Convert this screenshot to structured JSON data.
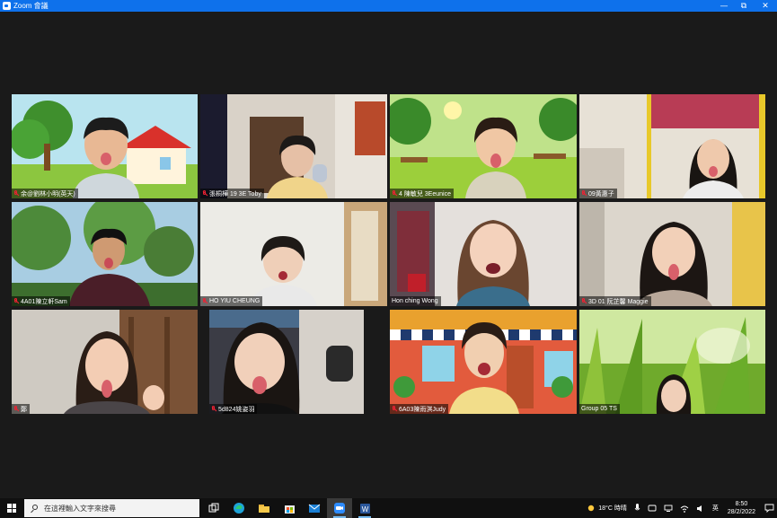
{
  "window": {
    "title": "Zoom 會議"
  },
  "controls": {
    "minimize": "—",
    "restore": "⧉",
    "close": "✕"
  },
  "gallery": [
    {
      "name": "余@劉林小明(英天)",
      "muted": true
    },
    {
      "name": "張桐樺 19 3E Toby",
      "muted": true
    },
    {
      "name": "4 陳敏兒 3Eeunice",
      "muted": true
    },
    {
      "name": "09黃惠子",
      "muted": true
    },
    {
      "name": "4A01陳立軒Sam",
      "muted": true
    },
    {
      "name": "HO YIU CHEUNG",
      "muted": true
    },
    {
      "name": "Hon ching Wong",
      "muted": false,
      "active": true
    },
    {
      "name": "3D 01 阮芷馨 Maggie",
      "muted": true
    },
    {
      "name": "鄭",
      "muted": true
    },
    {
      "name": "5d824姚姿羽",
      "muted": true
    },
    {
      "name": "6A03陳雨淇Judy",
      "muted": true
    },
    {
      "name": "Group 05 TS",
      "muted": true
    }
  ],
  "taskbar": {
    "search_placeholder": "在這裡輸入文字來搜尋",
    "apps": [
      "task-view",
      "edge",
      "file-explorer",
      "microsoft-store",
      "mail",
      "zoom",
      "word"
    ],
    "weather": "18°C 時晴",
    "ime": "英",
    "time": "8:50",
    "date": "28/2/2022"
  }
}
